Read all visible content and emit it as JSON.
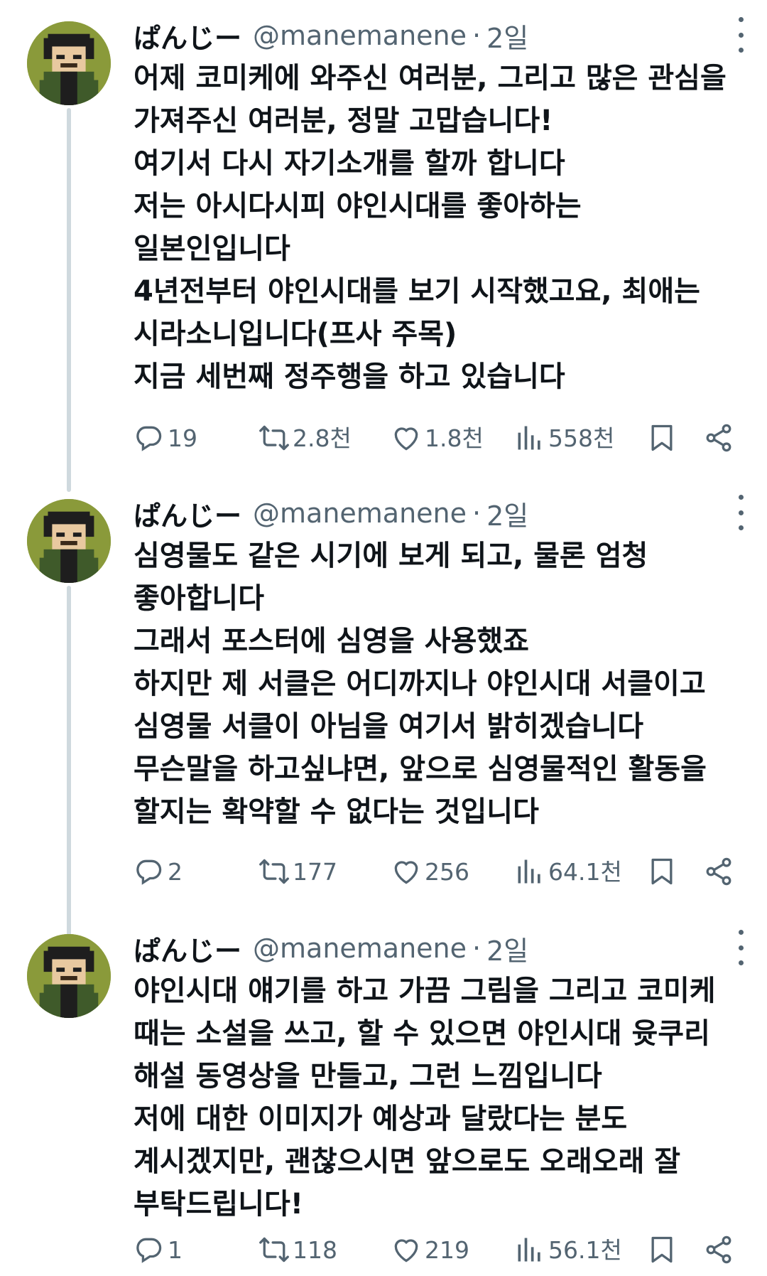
{
  "tweets": [
    {
      "name": "ぱんじー",
      "handle": "@manemanene",
      "separator": "·",
      "time": "2일",
      "text": "어제 코미케에 와주신 여러분, 그리고 많은 관심을\n가져주신 여러분, 정말 고맙습니다!\n여기서 다시 자기소개를 할까 합니다\n저는 아시다시피 야인시대를 좋아하는\n일본인입니다\n4년전부터 야인시대를 보기 시작했고요, 최애는\n시라소니입니다(프사 주목)\n지금 세번째 정주행을 하고 있습니다",
      "replies": "19",
      "retweets": "2.8천",
      "likes": "1.8천",
      "views": "558천"
    },
    {
      "name": "ぱんじー",
      "handle": "@manemanene",
      "separator": "·",
      "time": "2일",
      "text": "심영물도 같은 시기에 보게 되고, 물론 엄청\n좋아합니다\n그래서 포스터에 심영을 사용했죠\n하지만 제 서클은 어디까지나 야인시대 서클이고\n심영물 서클이 아님을 여기서 밝히겠습니다\n무슨말을 하고싶냐면, 앞으로 심영물적인 활동을\n할지는 확약할 수 없다는 것입니다",
      "replies": "2",
      "retweets": "177",
      "likes": "256",
      "views": "64.1천"
    },
    {
      "name": "ぱんじー",
      "handle": "@manemanene",
      "separator": "·",
      "time": "2일",
      "text": "야인시대 얘기를 하고 가끔 그림을 그리고 코미케\n때는 소설을 쓰고, 할 수 있으면 야인시대 윳쿠리\n해설 동영상을 만들고, 그런 느낌입니다\n저에 대한 이미지가 예상과 달랐다는 분도\n계시겠지만, 괜찮으시면 앞으로도 오래오래 잘\n부탁드립니다!",
      "replies": "1",
      "retweets": "118",
      "likes": "219",
      "views": "56.1천"
    }
  ],
  "icons": {
    "reply": "speech-bubble",
    "retweet": "retweet-arrows",
    "like": "heart",
    "views": "bar-chart",
    "bookmark": "bookmark",
    "share": "share-nodes",
    "more": "vertical-dots"
  },
  "colors": {
    "text": "#0f1419",
    "secondary": "#536471",
    "thread_line": "#cfd9de",
    "avatar_bg": "#8a9a3a"
  }
}
